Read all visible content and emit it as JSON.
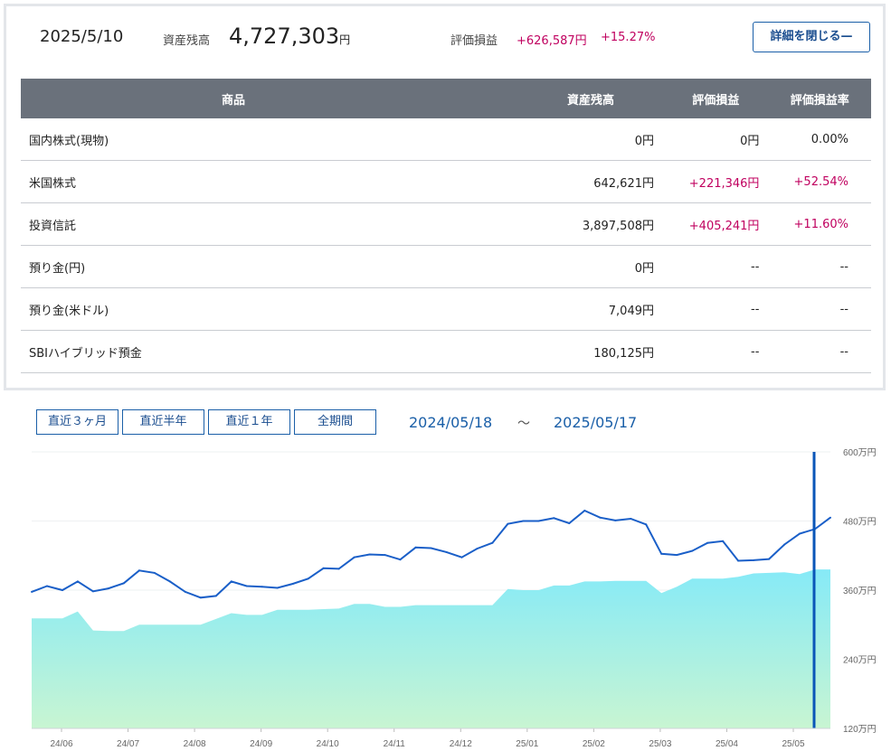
{
  "summary": {
    "date": "2025/5/10",
    "balance_label": "資産残高",
    "balance_value": "4,727,303",
    "balance_unit": "円",
    "pl_label": "評価損益",
    "pl_yen": "+626,587円",
    "pl_pct": "+15.27%",
    "close_button": "詳細を閉じる—"
  },
  "table": {
    "headers": [
      "商品",
      "資産残高",
      "評価損益",
      "評価損益率"
    ],
    "rows": [
      {
        "name": "国内株式(現物)",
        "balance": "0円",
        "pl": "0円",
        "rate": "0.00%",
        "positive": false
      },
      {
        "name": "米国株式",
        "balance": "642,621円",
        "pl": "+221,346円",
        "rate": "+52.54%",
        "positive": true
      },
      {
        "name": "投資信託",
        "balance": "3,897,508円",
        "pl": "+405,241円",
        "rate": "+11.60%",
        "positive": true
      },
      {
        "name": "預り金(円)",
        "balance": "0円",
        "pl": "--",
        "rate": "--",
        "positive": false
      },
      {
        "name": "預り金(米ドル)",
        "balance": "7,049円",
        "pl": "--",
        "rate": "--",
        "positive": false
      },
      {
        "name": "SBIハイブリッド預金",
        "balance": "180,125円",
        "pl": "--",
        "rate": "--",
        "positive": false
      }
    ]
  },
  "period_buttons": [
    "直近３ヶ月",
    "直近半年",
    "直近１年",
    "全期間"
  ],
  "date_range": {
    "from": "2024/05/18",
    "separator": "～",
    "to": "2025/05/17"
  },
  "colors": {
    "accent": "#1a5fa8",
    "positive": "#c0005f",
    "line": "#1a5fc8",
    "area_top": "#86eaf7",
    "area_bottom": "#c8f5d2",
    "header_bg": "#6a717b"
  },
  "chart_data": {
    "type": "area",
    "xlabels": [
      "24/06",
      "24/07",
      "24/08",
      "24/09",
      "24/10",
      "24/11",
      "24/12",
      "25/01",
      "25/02",
      "25/03",
      "25/04",
      "25/05"
    ],
    "yticks": [
      "600万円",
      "480万円",
      "360万円",
      "240万円",
      "120万円"
    ],
    "ytick_values": [
      600,
      480,
      360,
      240,
      120
    ],
    "ylim": [
      120,
      600
    ],
    "series": [
      {
        "values": [
          357,
          367,
          360,
          375,
          358,
          363,
          372,
          394,
          390,
          375,
          357,
          347,
          350,
          375,
          367,
          366,
          364,
          371,
          380,
          398,
          397,
          417,
          422,
          421,
          413,
          434,
          433,
          426,
          417,
          432,
          442,
          475,
          480,
          480,
          485,
          476,
          498,
          486,
          481,
          484,
          474,
          423,
          421,
          428,
          442,
          445,
          411,
          412,
          414,
          439,
          458,
          466,
          486
        ]
      },
      {
        "values": [
          311,
          311,
          311,
          323,
          290,
          289,
          289,
          300,
          300,
          300,
          300,
          300,
          310,
          320,
          317,
          317,
          326,
          326,
          326,
          327,
          328,
          336,
          336,
          331,
          331,
          334,
          334,
          334,
          334,
          334,
          334,
          362,
          360,
          360,
          368,
          368,
          375,
          375,
          376,
          376,
          376,
          355,
          366,
          380,
          380,
          380,
          383,
          389,
          390,
          391,
          388,
          396,
          396
        ]
      }
    ]
  }
}
